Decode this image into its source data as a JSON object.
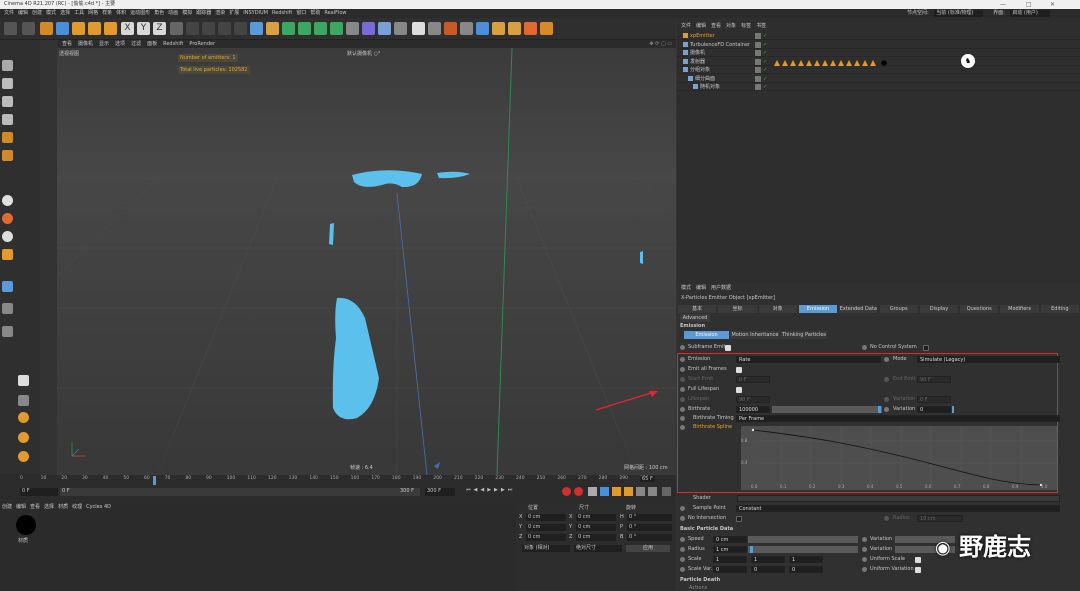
{
  "window": {
    "title": "Cinema 4D R21.207 (RC) - [偷偷.c4d *] - 主要",
    "min_symbol": "—",
    "max_symbol": "□",
    "close_symbol": "✕"
  },
  "menubar": [
    "文件",
    "编辑",
    "创建",
    "模式",
    "选择",
    "工具",
    "网格",
    "样条",
    "体积",
    "运动图形",
    "角色",
    "动画",
    "模拟",
    "跟踪器",
    "渲染",
    "扩展",
    "INSYDIUM",
    "Redshift",
    "窗口",
    "帮助",
    "RealFlow"
  ],
  "menubar_right": {
    "node_label": "节点空间:",
    "node_value": "当前 (标准/物理)",
    "layout_label": "界面:",
    "layout_value": "启动 (用户)"
  },
  "viewport": {
    "menu": [
      "查看",
      "摄像机",
      "显示",
      "选项",
      "过滤",
      "面板",
      "Redshift",
      "ProRender"
    ],
    "view_name": "透视视图",
    "camera_name": "默认摄像机 ○°",
    "hud_emitters": "Number of emitters: 1",
    "hud_particles": "Total live particles: 102582",
    "speed_label": "帧速 : 6.4",
    "grid_label": "网格间距 : 100 cm"
  },
  "timeline": {
    "ticks": [
      "0",
      "10",
      "20",
      "30",
      "40",
      "50",
      "60",
      "70",
      "80",
      "90",
      "100",
      "110",
      "120",
      "130",
      "140",
      "150",
      "160",
      "170",
      "180",
      "190",
      "200",
      "210",
      "220",
      "230",
      "240",
      "250",
      "260",
      "270",
      "280",
      "290",
      "300"
    ],
    "current_frame": "65 F",
    "start_field": "0 F",
    "start_field2": "0 F",
    "end_field": "300 F",
    "end_field2": "300 F"
  },
  "materials": {
    "menu": [
      "创建",
      "编辑",
      "查看",
      "选择",
      "材质",
      "纹理",
      "Cycles 4D"
    ],
    "mat_name": "材质"
  },
  "coords": {
    "headers": [
      "位置",
      "尺寸",
      "旋转"
    ],
    "rows": [
      {
        "axis": "X",
        "pos": "0 cm",
        "size_axis": "X",
        "size": "0 cm",
        "rot_axis": "H",
        "rot": "0 °"
      },
      {
        "axis": "Y",
        "pos": "0 cm",
        "size_axis": "Y",
        "size": "0 cm",
        "rot_axis": "P",
        "rot": "0 °"
      },
      {
        "axis": "Z",
        "pos": "0 cm",
        "size_axis": "Z",
        "size": "0 cm",
        "rot_axis": "B",
        "rot": "0 °"
      }
    ],
    "mode_object": "对象 (相对)",
    "mode_size": "绝对尺寸",
    "apply": "应用"
  },
  "objmgr": {
    "menu": [
      "文件",
      "编辑",
      "查看",
      "对象",
      "标签",
      "书签"
    ],
    "objects": [
      {
        "name": "xpEmitter",
        "color": "#f0a030",
        "indent": 0
      },
      {
        "name": "TurbulenceFD Container",
        "color": "#c8c8c8",
        "indent": 0
      },
      {
        "name": "摄像机",
        "color": "#c8c8c8",
        "indent": 0
      },
      {
        "name": "发射器",
        "color": "#c8c8c8",
        "indent": 0
      },
      {
        "name": "分组对象",
        "color": "#c8c8c8",
        "indent": 0
      },
      {
        "name": "细分曲面",
        "color": "#c8c8c8",
        "indent": 1
      },
      {
        "name": "随机对象",
        "color": "#c8c8c8",
        "indent": 2
      }
    ]
  },
  "attr": {
    "menu": [
      "模式",
      "编辑",
      "用户数据"
    ],
    "object_title": "X-Particles Emitter Object [xpEmitter]",
    "tabs": [
      "基本",
      "坐标",
      "对象",
      "Emission",
      "Extended Data",
      "Groups",
      "Display",
      "Questions",
      "Modifiers",
      "Editing"
    ],
    "tab2": "Advanced",
    "active_tab": "Emission",
    "section_title": "Emission",
    "subtabs": [
      "Emission",
      "Motion Inheritance",
      "Thinking Particles"
    ],
    "subframe_emit": "Subframe Emit",
    "no_control": "No Control System",
    "emission_label": "Emission",
    "emission_value": "Rate",
    "mode_label": "Mode",
    "mode_value": "Simulate (Legacy)",
    "emit_all": "Emit all Frames",
    "start_emit": "Start Emit",
    "start_emit_val": "0 F",
    "end_emit": "End Emit",
    "end_emit_val": "90 F",
    "full_lifespan": "Full Lifespan",
    "lifespan": "Lifespan",
    "lifespan_val": "90 F",
    "variation": "Variation",
    "variation_val": "0 F",
    "birthrate": "Birthrate",
    "birthrate_val": "100000",
    "variation2": "Variation",
    "variation2_val": "0",
    "birthrate_timing": "Birthrate Timing",
    "birthrate_timing_val": "Per Frame",
    "birthrate_spline": "Birthrate Spline",
    "spline_y": [
      "0.8",
      "0.4"
    ],
    "spline_x": [
      "0.0",
      "0.1",
      "0.2",
      "0.3",
      "0.4",
      "0.5",
      "0.6",
      "0.7",
      "0.8",
      "0.9",
      "1.0"
    ],
    "shader": "Shader",
    "sample_point": "Sample Point",
    "sample_point_val": "Constant",
    "no_intersection": "No Intersection",
    "radius_label": "Radius",
    "radius_val": "10 cm",
    "basic_data": "Basic Particle Data",
    "speed": "Speed",
    "speed_val": "0 cm",
    "radius2": "Radius",
    "radius2_val": "1 cm",
    "scale": "Scale",
    "scale_vals": [
      "1",
      "1",
      "1"
    ],
    "scale_var": "Scale Var.",
    "scale_var_vals": [
      "0",
      "0",
      "0"
    ],
    "variation_a": "Variation",
    "variation_b": "Variation",
    "uniform_scale": "Uniform Scale",
    "uniform_var": "Uniform Variation",
    "particle_death": "Particle Death",
    "actions": "Actions"
  },
  "watermark": {
    "text": "野鹿志"
  },
  "colors": {
    "accent": "#5b9bd5",
    "highlight_red": "#e0282e",
    "particles": "#5bc0eb",
    "orange": "#f0a030"
  }
}
